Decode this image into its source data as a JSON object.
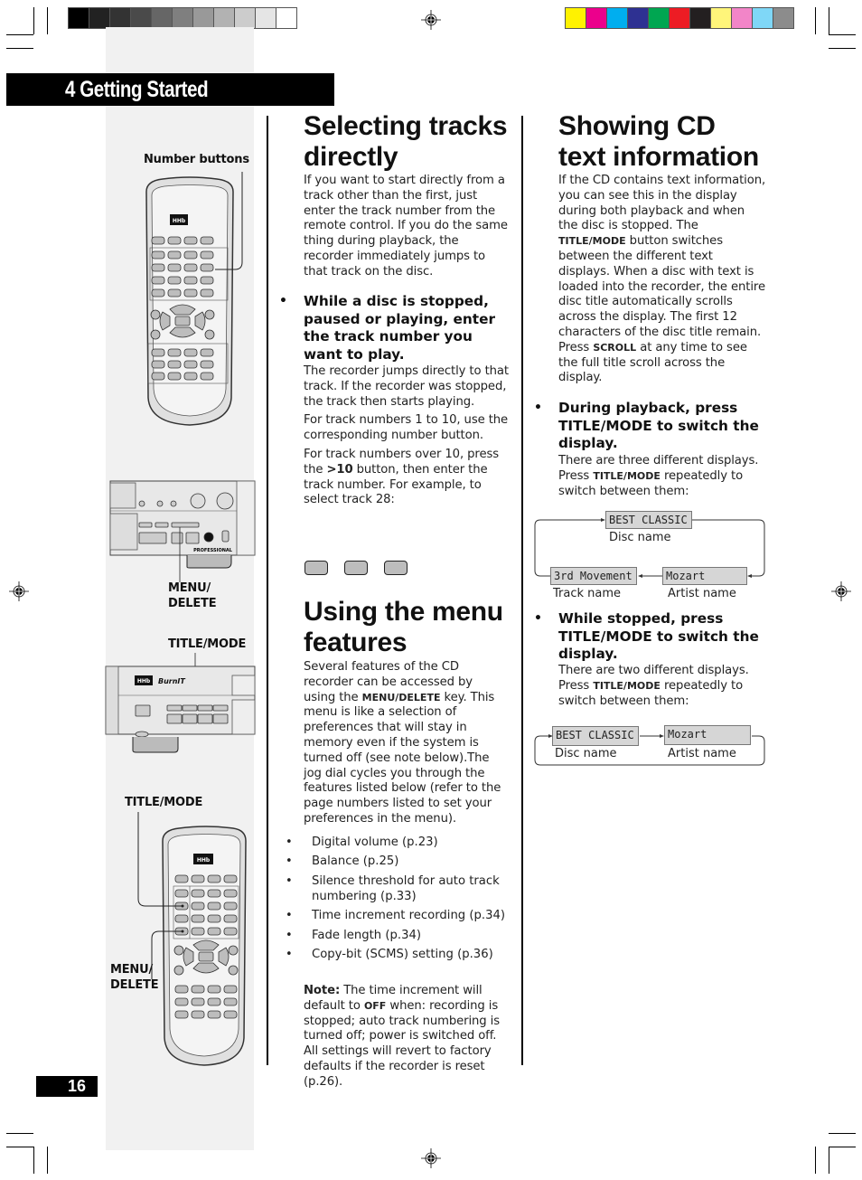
{
  "color_bars": {
    "grayscale": [
      "#000000",
      "#222222",
      "#333333",
      "#4a4a4a",
      "#666666",
      "#7f7f7f",
      "#999999",
      "#b2b2b2",
      "#cccccc",
      "#e5e5e5",
      "#ffffff"
    ],
    "process": [
      "#fff200",
      "#ec008c",
      "#00aeef",
      "#2e3192",
      "#00a651",
      "#ed1c24",
      "#231f20",
      "#fff57a",
      "#f285c8",
      "#7fd7f7",
      "#8c8c8c"
    ]
  },
  "header": {
    "chapter_title": "4 Getting Started",
    "page_number": "16"
  },
  "illustrations": {
    "remote1_label": "Number buttons",
    "front1_label_menu_line1": "MENU/",
    "front1_label_menu_line2": "DELETE",
    "front1_brand": "PROFESSIONAL",
    "front2_label_title": "TITLE/MODE",
    "front2_brand": "BurnIT",
    "remote2_label_title": "TITLE/MODE",
    "remote2_label_menu_line1": "MENU/",
    "remote2_label_menu_line2": "DELETE"
  },
  "section1": {
    "title_line1": "Selecting tracks",
    "title_line2": "directly",
    "intro": "If you want to start directly from a track other than the first, just enter the track number from the remote control. If you do the same thing during playback, the recorder immediately jumps to that track on the disc.",
    "bullet": "While a disc is stopped, paused or playing, enter the track number you want to play.",
    "para1": "The recorder jumps directly to that track. If the recorder was stopped, the track then starts playing.",
    "para2": "For track numbers 1 to 10, use the corresponding number button.",
    "para3_pre": "For track numbers over 10, press the ",
    "para3_key": ">10",
    "para3_post": " button, then enter the track number. For example, to select track 28:"
  },
  "section2": {
    "title_line1": "Using the menu",
    "title_line2": "features",
    "intro_pre": "Several features of the CD recorder can be accessed by using the ",
    "intro_key": "MENU/DELETE",
    "intro_post": " key. This menu is like a selection of preferences that will stay in memory even if the system is turned off (see note below).The jog dial cycles you through the features listed below (refer to the page numbers listed to set your preferences in the menu).",
    "features": [
      "Digital volume (p.23)",
      "Balance (p.25)",
      "Silence threshold for auto track numbering (p.33)",
      "Time increment recording (p.34)",
      "Fade length (p.34)",
      "Copy-bit (SCMS) setting (p.36)"
    ],
    "note_label": "Note:",
    "note_pre": " The time increment will default to ",
    "note_key": "OFF",
    "note_post": " when: recording is stopped; auto track numbering is turned off; power is switched off. All settings will revert to factory defaults if the recorder is reset (p.26)."
  },
  "section3": {
    "title_line1": "Showing CD",
    "title_line2": "text information",
    "intro_a": "If the CD contains text information, you can see this in the display during both playback and when the disc is stopped. The ",
    "intro_key1": "TITLE/MODE",
    "intro_b": " button switches between the different text displays. When a disc with text is loaded into the recorder, the entire disc title automatically scrolls across the display. The first 12 characters of the disc title remain. Press ",
    "intro_key2": "SCROLL",
    "intro_c": " at any time to see the full title scroll across the display.",
    "bullet1": "During playback, press TITLE/MODE to switch the display.",
    "bullet1_body_a": "There are three different displays. Press ",
    "bullet1_body_key": "TITLE/MODE",
    "bullet1_body_b": " repeatedly to switch between them:",
    "diagram1": {
      "disc_lcd": "BEST CLASSIC",
      "disc_cap": "Disc name",
      "track_lcd": "3rd Movement",
      "track_cap": "Track name",
      "artist_lcd": "Mozart",
      "artist_cap": "Artist name"
    },
    "bullet2": "While stopped, press TITLE/MODE to switch the display.",
    "bullet2_body_a": "There are two different displays. Press ",
    "bullet2_body_key": "TITLE/MODE",
    "bullet2_body_b": " repeatedly to switch between them:",
    "diagram2": {
      "disc_lcd": "BEST CLASSIC",
      "disc_cap": "Disc name",
      "artist_lcd": "Mozart",
      "artist_cap": "Artist name"
    }
  }
}
